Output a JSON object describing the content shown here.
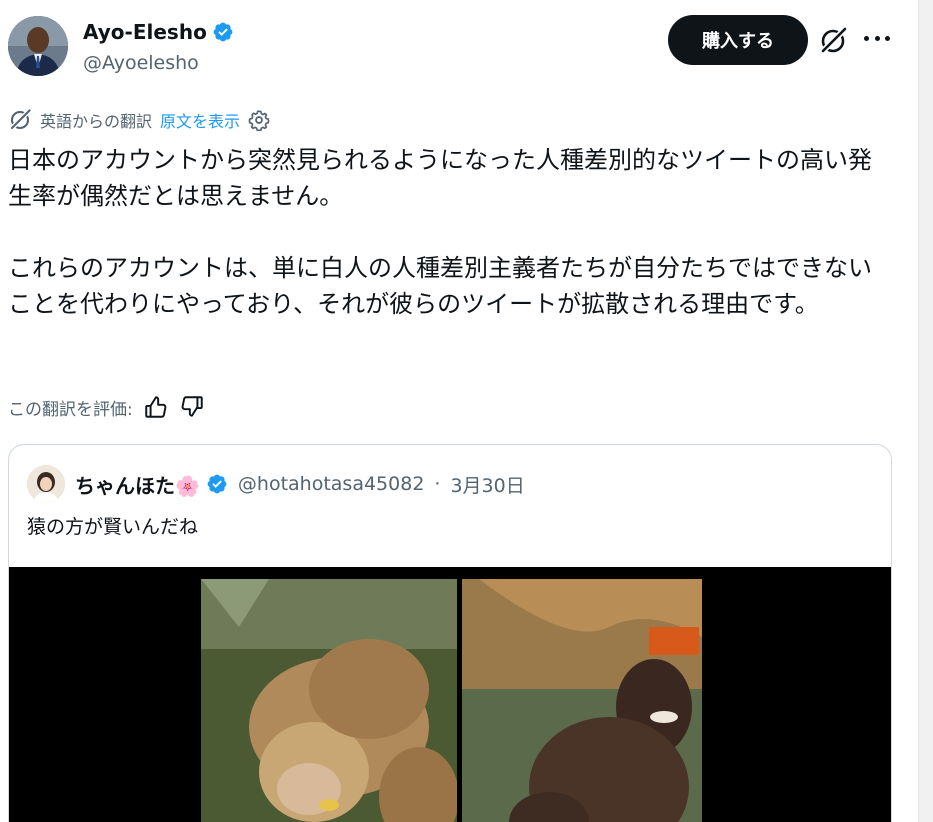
{
  "author": {
    "display_name": "Ayo-Elesho",
    "handle": "@Ayoelesho",
    "verified": true
  },
  "actions": {
    "buy_label": "購入する",
    "grok_icon": "grok-icon",
    "more_icon": "more-icon"
  },
  "translation": {
    "label": "英語からの翻訳",
    "show_original": "原文を表示"
  },
  "tweet": {
    "text": "日本のアカウントから突然見られるようになった人種差別的なツイートの高い発生率が偶然だとは思えません。\n\nこれらのアカウントは、単に白人の人種差別主義者たちが自分たちではできないことを代わりにやっており、それが彼らのツイートが拡散される理由です。"
  },
  "rating": {
    "label": "この翻訳を評価:"
  },
  "quoted": {
    "display_name": "ちゃんほた🌸",
    "handle": "@hotahotasa45082",
    "separator": "·",
    "date": "3月30日",
    "verified": true,
    "text": "猿の方が賢いんだね"
  },
  "colors": {
    "text": "#0f1419",
    "secondary": "#536471",
    "link": "#1d9bf0",
    "verified": "#1d9bf0",
    "button_bg": "#0f1419",
    "border": "#cfd9de"
  }
}
